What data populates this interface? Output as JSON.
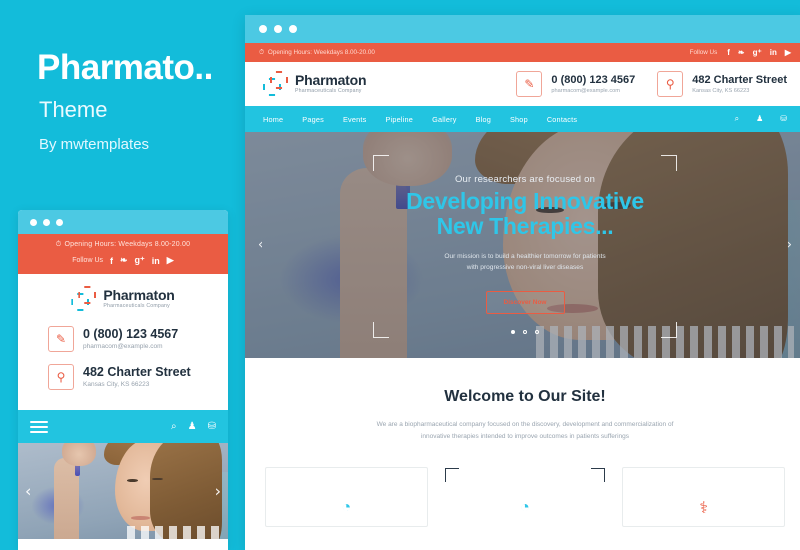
{
  "promo": {
    "title": "Pharmato..",
    "subtitle": "Theme",
    "author": "By mwtemplates",
    "bg_color": "#13bcda"
  },
  "colors": {
    "cyan": "#13bcda",
    "nav_cyan": "#22c4e0",
    "orange": "#ea5c43",
    "dark": "#22313f",
    "hero_title": "#2fc6e8"
  },
  "topbar": {
    "clock_icon": "clock-icon",
    "hours": "Opening Hours: Weekdays 8.00-20.00",
    "follow_label": "Follow Us",
    "socials": [
      {
        "name": "facebook-icon",
        "glyph": "f"
      },
      {
        "name": "twitter-icon",
        "glyph": "❧"
      },
      {
        "name": "google-plus-icon",
        "glyph": "g⁺"
      },
      {
        "name": "linkedin-icon",
        "glyph": "in"
      },
      {
        "name": "youtube-icon",
        "glyph": "▶"
      }
    ]
  },
  "brand": {
    "logo_icon": "pharmaton-cross-logo-icon",
    "name": "Pharmaton",
    "tagline": "Pharmaceuticals Company"
  },
  "contacts": {
    "phone": {
      "icon": "phone-icon",
      "number": "0 (800) 123 4567",
      "email": "pharmacom@example.com"
    },
    "address": {
      "icon": "map-pin-icon",
      "street": "482 Charter Street",
      "city": "Kansas City, KS 66223"
    }
  },
  "nav": {
    "items": [
      {
        "label": "Home",
        "name": "nav-item-home"
      },
      {
        "label": "Pages",
        "name": "nav-item-pages"
      },
      {
        "label": "Events",
        "name": "nav-item-events"
      },
      {
        "label": "Pipeline",
        "name": "nav-item-pipeline"
      },
      {
        "label": "Gallery",
        "name": "nav-item-gallery"
      },
      {
        "label": "Blog",
        "name": "nav-item-blog"
      },
      {
        "label": "Shop",
        "name": "nav-item-shop"
      },
      {
        "label": "Contacts",
        "name": "nav-item-contacts"
      }
    ],
    "icons": [
      {
        "name": "search-icon",
        "glyph": "⌕"
      },
      {
        "name": "user-icon",
        "glyph": "♟"
      },
      {
        "name": "cart-icon",
        "glyph": "⛁"
      }
    ]
  },
  "hero": {
    "eyebrow": "Our researchers are focused on",
    "title_line1": "Developing Innovative",
    "title_line2": "New Therapies...",
    "desc_line1": "Our mission is to build a healthier tomorrow for patients",
    "desc_line2": "with progressive non-viral liver diseases",
    "button_label": "Discover Now",
    "prev_arrow": "‹",
    "next_arrow": "›",
    "slides_total": 3,
    "slide_active": 1
  },
  "welcome": {
    "title": "Welcome to Our Site!",
    "desc_line1": "We are a biopharmaceutical company focused on the discovery, development and commercialization of",
    "desc_line2": "innovative therapies intended to improve outcomes in patients sufferings"
  },
  "cards": [
    {
      "name": "feature-card-1",
      "icon": "cyan-circle-icon",
      "glyph": "◔",
      "featured": false
    },
    {
      "name": "feature-card-2",
      "icon": "cyan-circle-icon",
      "glyph": "◔",
      "featured": true
    },
    {
      "name": "feature-card-3",
      "icon": "orange-flask-icon",
      "glyph": "⚕",
      "featured": false
    }
  ],
  "mobile": {
    "menu_icon": "hamburger-menu-icon",
    "icons": [
      {
        "name": "search-icon",
        "glyph": "⌕"
      },
      {
        "name": "user-icon",
        "glyph": "♟"
      },
      {
        "name": "cart-icon",
        "glyph": "⛁"
      }
    ],
    "prev_arrow": "‹",
    "next_arrow": "›"
  }
}
